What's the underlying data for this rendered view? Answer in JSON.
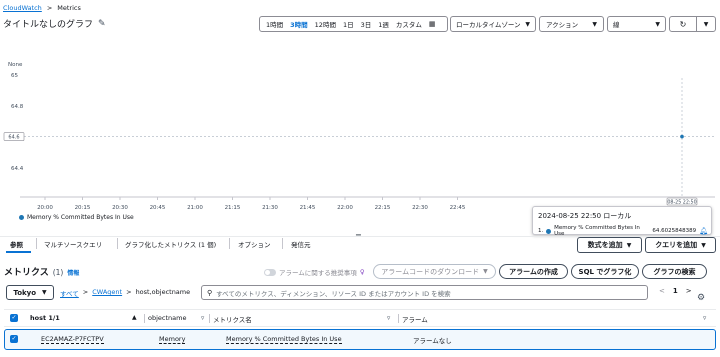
{
  "breadcrumb": {
    "root": "CloudWatch",
    "sep": ">",
    "current": "Metrics"
  },
  "title": "タイトルなしのグラフ",
  "toolbar": {
    "ranges": [
      "1時間",
      "3時間",
      "12時間",
      "1日",
      "3日",
      "1週",
      "カスタム"
    ],
    "active_range": "3時間",
    "timezone": "ローカルタイムゾーン",
    "actions": "アクション",
    "chart_type": "線"
  },
  "chart_data": {
    "type": "line",
    "ylabel": "None",
    "yticks": [
      "65",
      "64.8",
      "64.6",
      "64.4"
    ],
    "ylim": [
      64.3,
      65.05
    ],
    "xticks": [
      "20:00",
      "20:15",
      "20:30",
      "20:45",
      "21:00",
      "21:15",
      "21:30",
      "21:45",
      "22:00",
      "22:15",
      "22:30",
      "22:45"
    ],
    "series": [
      {
        "name": "Memory % Committed Bytes In Use",
        "color": "#1f77b4",
        "points": [
          {
            "x": "2024-08-25 22:50",
            "y": 64.6025848389
          }
        ]
      }
    ],
    "cursor_label": "08-25 22:50"
  },
  "tooltip": {
    "title": "2024-08-25 22:50 ローカル",
    "index": "1.",
    "name": "Memory % Committed Bytes In Use",
    "value": "64.6025848389"
  },
  "tabs": [
    "参照",
    "マルチソースクエリ",
    "グラフ化したメトリクス (1 個)",
    "オプション",
    "発信元"
  ],
  "tab_buttons": {
    "add_math": "数式を追加",
    "add_query": "クエリを追加"
  },
  "metrics": {
    "title": "メトリクス",
    "count": "(1)",
    "info": "情報",
    "alarm_toggle": "アラームに関する推奨事項",
    "download_alarm_code": "アラームコードのダウンロード",
    "create_alarm": "アラームの作成",
    "graph_sql": "SQL でグラフ化",
    "graph_search": "グラフの検索"
  },
  "filter": {
    "region": "Tokyo",
    "crumb_all": "すべて",
    "crumb_ns": "CWAgent",
    "crumb_dim": "host,objectname",
    "placeholder": "すべてのメトリクス、ディメンション、リソース ID またはアカウント ID を検索",
    "page": "1"
  },
  "table": {
    "headers": [
      "host 1/1",
      "objectname",
      "メトリクス名",
      "アラーム"
    ],
    "rows": [
      {
        "host": "EC2AMAZ-P7FCTPV",
        "objectname": "Memory",
        "metric": "Memory % Committed Bytes In Use",
        "alarm": "アラームなし"
      }
    ]
  },
  "colors": {
    "accent": "#0972d3",
    "series": "#1f77b4"
  }
}
